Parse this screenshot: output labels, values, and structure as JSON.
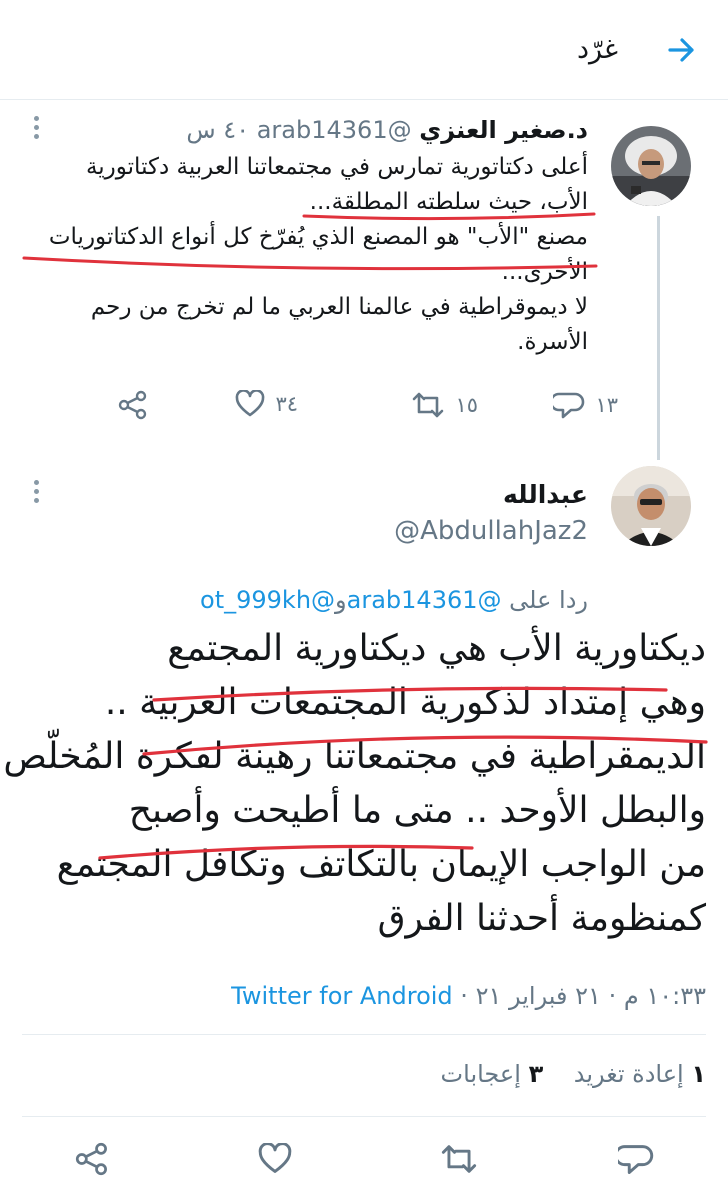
{
  "header": {
    "title": "غرّد",
    "back_icon": "arrow-right-icon",
    "accent": "#1b95e0"
  },
  "tweet1": {
    "name": "د.صغير العنزي",
    "handle": "@arab14361",
    "time": "٤٠ س",
    "lines": [
      "أعلى دكتاتورية تمارس في مجتمعاتنا العربية دكتاتورية",
      "الأب، حيث سلطته المطلقة...",
      "مصنع \"الأب\" هو المصنع الذي يُفرّخ كل أنواع الدكتاتوريات",
      "الأخرى...",
      "لا ديموقراطية في عالمنا العربي ما لم تخرج من رحم",
      "الأسرة."
    ],
    "actions": {
      "replies": "١٣",
      "retweets": "١٥",
      "likes": "٣٤"
    }
  },
  "tweet2": {
    "name": "عبدالله",
    "handle": "@AbdullahJaz2",
    "replying_prefix": "ردا على",
    "replying_mention1": "@arab14361",
    "replying_and": "و",
    "replying_mention2": "@ot_999kh",
    "lines": [
      "ديكتاورية الأب هي ديكتاورية المجتمع",
      "وهي إمتداد لذكورية المجتمعات العربية ..",
      "الديمقراطية في مجتمعاتنا رهينة لفكرة المُخلّص",
      "والبطل الأوحد .. متى ما أطيحت وأصبح",
      "من الواجب الإيمان بالتكاتف وتكافل المجتمع",
      "كمنظومة أحدثنا الفرق"
    ],
    "time": "١٠:٣٣ م",
    "date": "٢١ فبراير ٢١",
    "source": "Twitter for Android",
    "retweet_count": "١",
    "retweet_label": "إعادة تغريد",
    "like_count": "٣",
    "like_label": "إعجابات"
  },
  "icons": [
    "reply-icon",
    "retweet-icon",
    "like-icon",
    "share-icon",
    "more-icon"
  ],
  "annotation_color": "#e0323c"
}
